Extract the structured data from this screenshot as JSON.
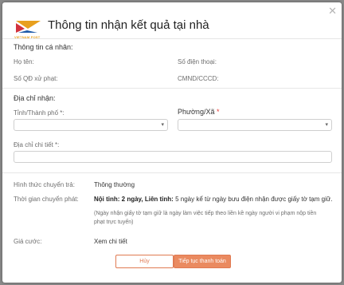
{
  "dialog": {
    "close_icon": "close-icon",
    "title": "Thông tin nhận kết quả tại nhà",
    "logo_text": "VIETNAM POST",
    "logo_color": "#e8a01e"
  },
  "personal": {
    "heading": "Thông tin cá nhân:",
    "name_label": "Họ tên:",
    "phone_label": "Số điện thoại:",
    "decision_label": "Số QĐ xử phạt:",
    "id_label": "CMND/CCCD:"
  },
  "address": {
    "heading": "Địa chỉ nhận:",
    "province_label": "Tỉnh/Thành phố",
    "ward_label": "Phường/Xã",
    "required_mark": "*",
    "province_value": "",
    "ward_value": "",
    "detail_label": "Địa chỉ chi tiết",
    "detail_value": "",
    "dropdown_icon": "chevron-down-icon"
  },
  "shipping": {
    "method_label": "Hình thức chuyển trả:",
    "method_value": "Thông thường",
    "time_label": "Thời gian chuyển phát:",
    "time_inner_bold": "Nội tỉnh: 2 ngày, Liên tỉnh:",
    "time_rest": "5 ngày kể từ ngày bưu điện nhận được giấy tờ tạm giữ.",
    "note_line1": "(Ngày nhận giấy tờ tạm giữ là ngày làm việc tiếp theo liền kề ngày người vi phạm nộp tiền",
    "note_line2": "phạt trực tuyến)",
    "fee_label": "Giá cước:",
    "fee_value": "Xem chi tiết"
  },
  "actions": {
    "cancel_label": "Hủy",
    "continue_label": "Tiếp tục thanh toán",
    "accent_color": "#ea8a60"
  }
}
